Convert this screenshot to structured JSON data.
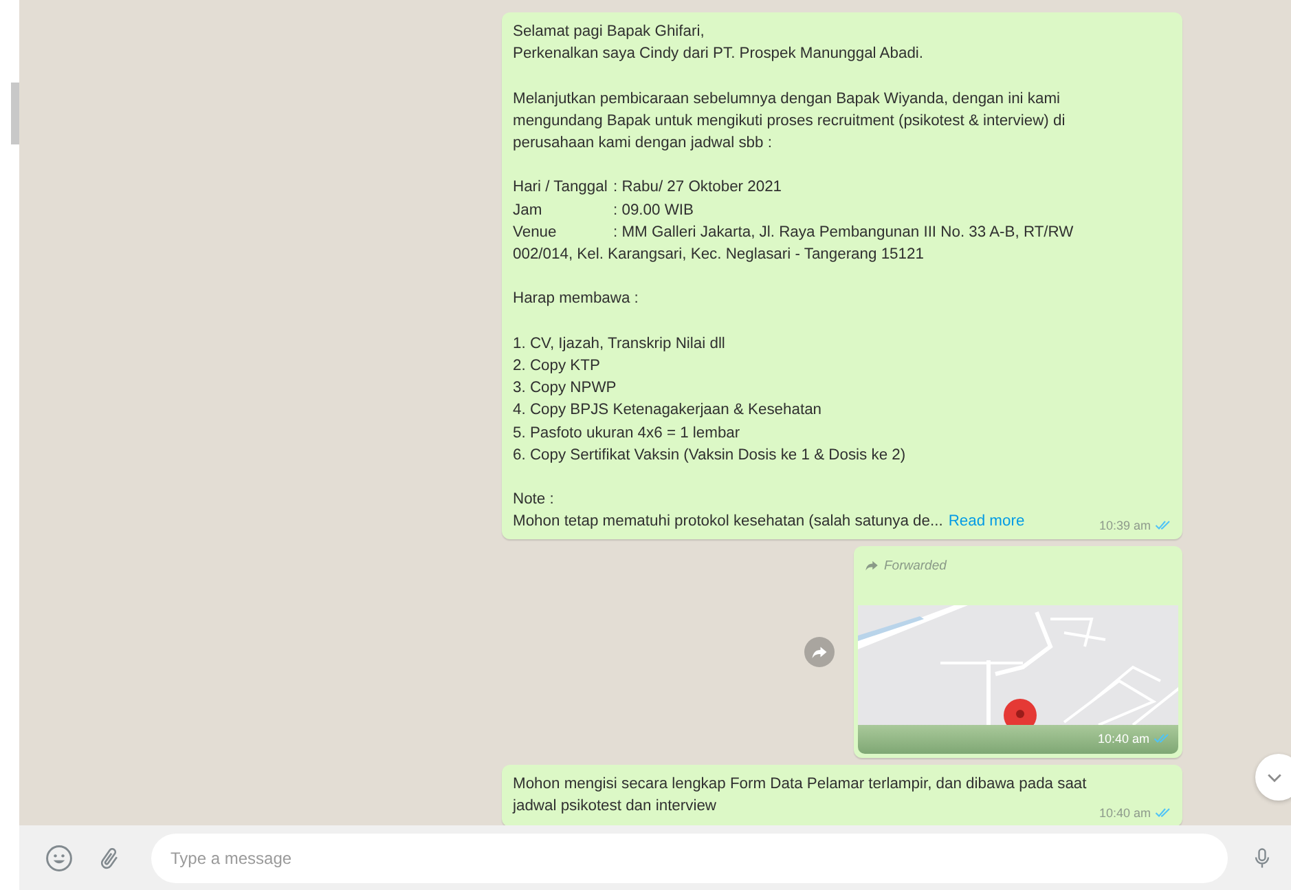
{
  "messages": [
    {
      "kind": "text",
      "paragraphs": [
        {
          "kind": "lines",
          "lines": [
            "Selamat pagi Bapak Ghifari,",
            "Perkenalkan saya Cindy dari PT. Prospek Manunggal Abadi."
          ]
        },
        {
          "kind": "lines",
          "lines": [
            "Melanjutkan pembicaraan sebelumnya dengan Bapak Wiyanda, dengan ini kami",
            "mengundang Bapak untuk mengikuti proses recruitment (psikotest & interview) di",
            "perusahaan kami dengan jadwal sbb :"
          ]
        },
        {
          "kind": "fields",
          "fields": [
            {
              "label": "Hari / Tanggal",
              "value": ": Rabu/ 27 Oktober 2021"
            },
            {
              "label": "Jam",
              "value": ": 09.00 WIB"
            },
            {
              "label": "Venue",
              "value": ": MM Galleri Jakarta, Jl. Raya Pembangunan III No. 33 A-B, RT/RW"
            }
          ],
          "continuation": "002/014, Kel. Karangsari, Kec. Neglasari - Tangerang 15121"
        },
        {
          "kind": "lines",
          "lines": [
            "Harap membawa :"
          ]
        },
        {
          "kind": "lines",
          "lines": [
            "1. CV, Ijazah, Transkrip Nilai dll",
            "2. Copy KTP",
            "3. Copy NPWP",
            "4. Copy BPJS Ketenagakerjaan & Kesehatan",
            "5. Pasfoto ukuran 4x6 = 1 lembar",
            "6. Copy Sertifikat Vaksin (Vaksin Dosis ke 1 & Dosis ke 2)"
          ]
        },
        {
          "kind": "lines",
          "lines": [
            "Note :"
          ]
        },
        {
          "kind": "truncated",
          "text": "Mohon tetap mematuhi protokol kesehatan (salah satunya de...",
          "link": "Read more"
        }
      ],
      "time": "10:39 am",
      "read": true
    },
    {
      "kind": "location",
      "forwarded_label": "Forwarded",
      "time": "10:40 am",
      "read": true
    },
    {
      "kind": "text",
      "paragraphs": [
        {
          "kind": "lines",
          "lines": [
            "Mohon mengisi secara lengkap Form Data Pelamar terlampir, dan dibawa pada saat",
            "jadwal psikotest dan interview"
          ]
        }
      ],
      "time": "10:40 am",
      "read": true
    }
  ],
  "composer": {
    "placeholder": "Type a message"
  }
}
